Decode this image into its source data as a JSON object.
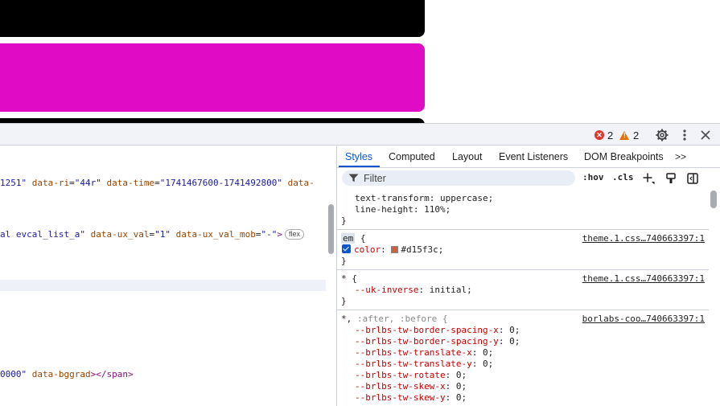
{
  "topbar": {
    "errors_count": "2",
    "warnings_count": "2"
  },
  "elements": {
    "lines": [
      {
        "parts": [
          {
            "k": "attr-val",
            "t": "1251\""
          },
          {
            "k": "plain",
            "t": " "
          },
          {
            "k": "attr-name",
            "t": "data-ri"
          },
          {
            "k": "plain",
            "t": "="
          },
          {
            "k": "attr-val",
            "t": "\"44r\""
          },
          {
            "k": "plain",
            "t": " "
          },
          {
            "k": "attr-name",
            "t": "data-time"
          },
          {
            "k": "plain",
            "t": "="
          },
          {
            "k": "attr-val",
            "t": "\"1741467600-1741492800\""
          },
          {
            "k": "plain",
            "t": " "
          },
          {
            "k": "attr-name",
            "t": "data-"
          }
        ]
      },
      {
        "parts": [
          {
            "k": "attr-val",
            "t": "al evcal_list_a\""
          },
          {
            "k": "plain",
            "t": " "
          },
          {
            "k": "attr-name",
            "t": "data-ux_val"
          },
          {
            "k": "plain",
            "t": "="
          },
          {
            "k": "attr-val",
            "t": "\"1\""
          },
          {
            "k": "plain",
            "t": " "
          },
          {
            "k": "attr-name",
            "t": "data-ux_val_mob"
          },
          {
            "k": "plain",
            "t": "="
          },
          {
            "k": "attr-val",
            "t": "\"-\""
          },
          {
            "k": "tag",
            "t": ">"
          }
        ],
        "badge": "flex"
      },
      {
        "parts": [
          {
            "k": "attr-val",
            "t": "0000\""
          },
          {
            "k": "plain",
            "t": " "
          },
          {
            "k": "attr-name",
            "t": "data-bggrad"
          },
          {
            "k": "tag",
            "t": "></span>"
          }
        ]
      }
    ]
  },
  "styles": {
    "tabs": [
      "Styles",
      "Computed",
      "Layout",
      "Event Listeners",
      "DOM Breakpoints"
    ],
    "more_tabs": ">>",
    "filter_placeholder": "Filter",
    "hov": ":hov",
    "cls": ".cls",
    "rule0": {
      "p1": "text-transform",
      "v1": "uppercase",
      "p2": "line-height",
      "v2": "110%"
    },
    "rule1": {
      "selector": "em",
      "source": "theme.1.css…740663397:1",
      "prop": "color",
      "value": "#d15f3c",
      "swatch": "#d15f3c"
    },
    "rule2": {
      "selector": "* {",
      "source": "theme.1.css…740663397:1",
      "prop": "--uk-inverse",
      "value": "initial"
    },
    "rule3": {
      "selector_main": "*,",
      "selector_rest": " :after, :before {",
      "source": "borlabs-coo…740663397:1",
      "props": [
        {
          "p": "--brlbs-tw-border-spacing-x",
          "v": "0"
        },
        {
          "p": "--brlbs-tw-border-spacing-y",
          "v": "0"
        },
        {
          "p": "--brlbs-tw-translate-x",
          "v": "0"
        },
        {
          "p": "--brlbs-tw-translate-y",
          "v": "0"
        },
        {
          "p": "--brlbs-tw-rotate",
          "v": "0"
        },
        {
          "p": "--brlbs-tw-skew-x",
          "v": "0"
        },
        {
          "p": "--brlbs-tw-skew-y",
          "v": "0"
        }
      ]
    }
  }
}
